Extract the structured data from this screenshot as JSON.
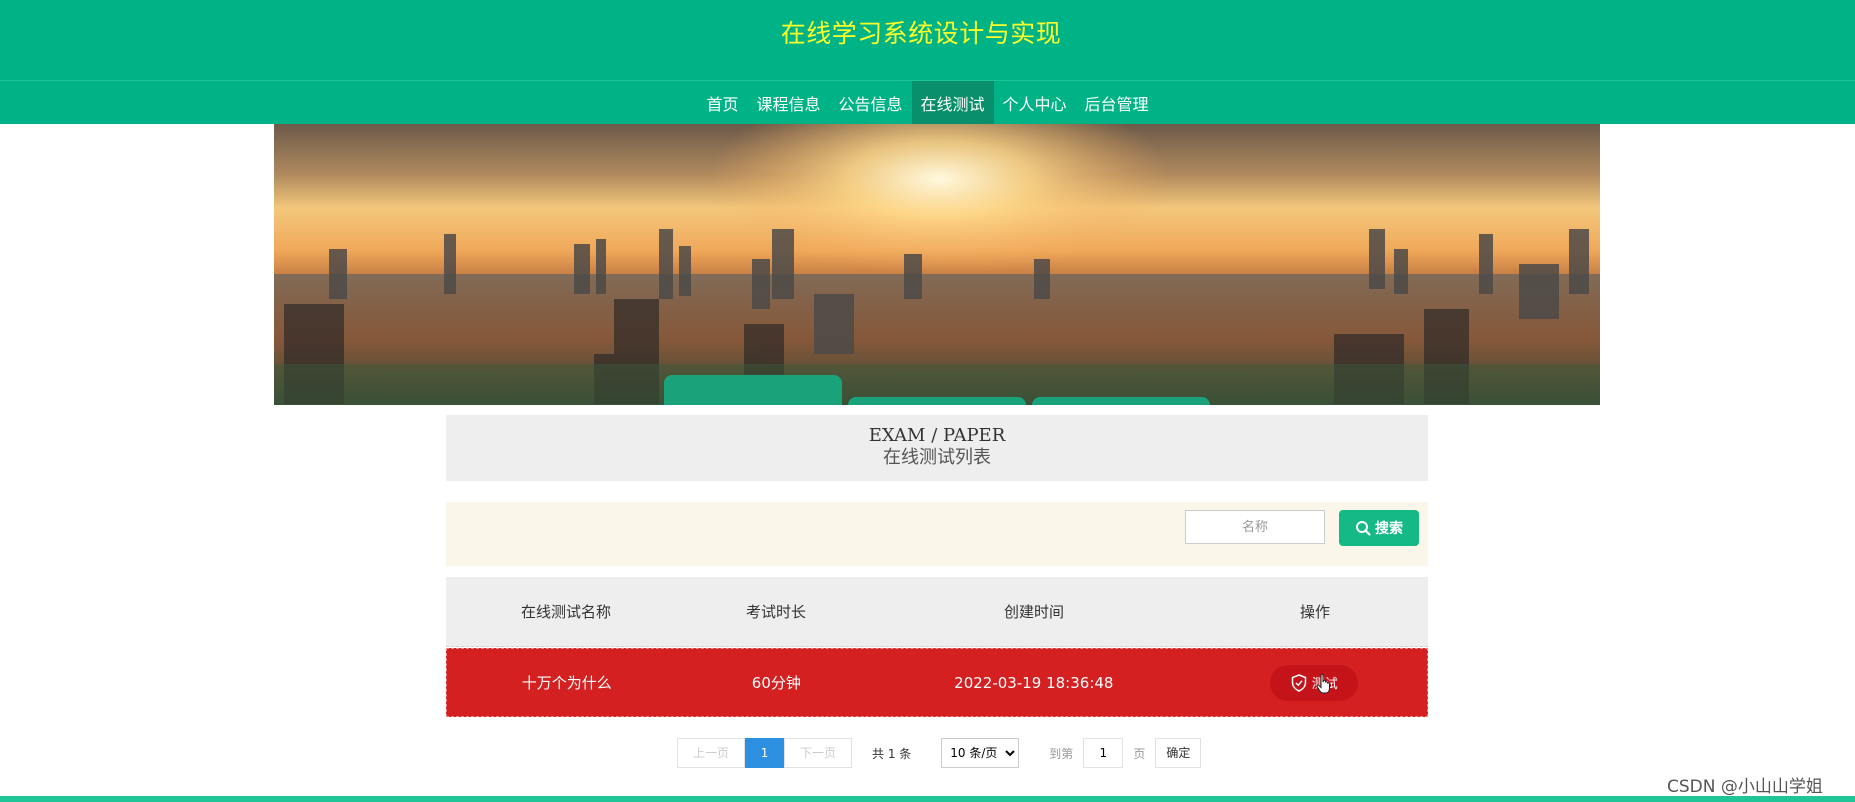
{
  "site": {
    "title": "在线学习系统设计与实现"
  },
  "nav": {
    "items": [
      {
        "label": "首页"
      },
      {
        "label": "课程信息"
      },
      {
        "label": "公告信息"
      },
      {
        "label": "在线测试",
        "active": true
      },
      {
        "label": "个人中心"
      },
      {
        "label": "后台管理"
      }
    ]
  },
  "list_header": {
    "en": "EXAM / PAPER",
    "cn": "在线测试列表"
  },
  "search": {
    "placeholder": "名称",
    "value": "",
    "button_label": "搜索"
  },
  "table": {
    "columns": [
      "在线测试名称",
      "考试时长",
      "创建时间",
      "操作"
    ],
    "rows": [
      {
        "name": "十万个为什么",
        "duration": "60分钟",
        "created": "2022-03-19 18:36:48",
        "action": "测试"
      }
    ]
  },
  "pagination": {
    "prev": "上一页",
    "current": "1",
    "next": "下一页",
    "total": "共 1 条",
    "page_size": "10 条/页",
    "goto_label": "到第",
    "goto_value": "1",
    "page_unit": "页",
    "confirm": "确定"
  },
  "watermark": "CSDN @小山山学姐",
  "colors": {
    "primary": "#00b386",
    "title_yellow": "#fbff2a",
    "row_highlight": "#d42020",
    "pager_active": "#2d8fe0"
  }
}
